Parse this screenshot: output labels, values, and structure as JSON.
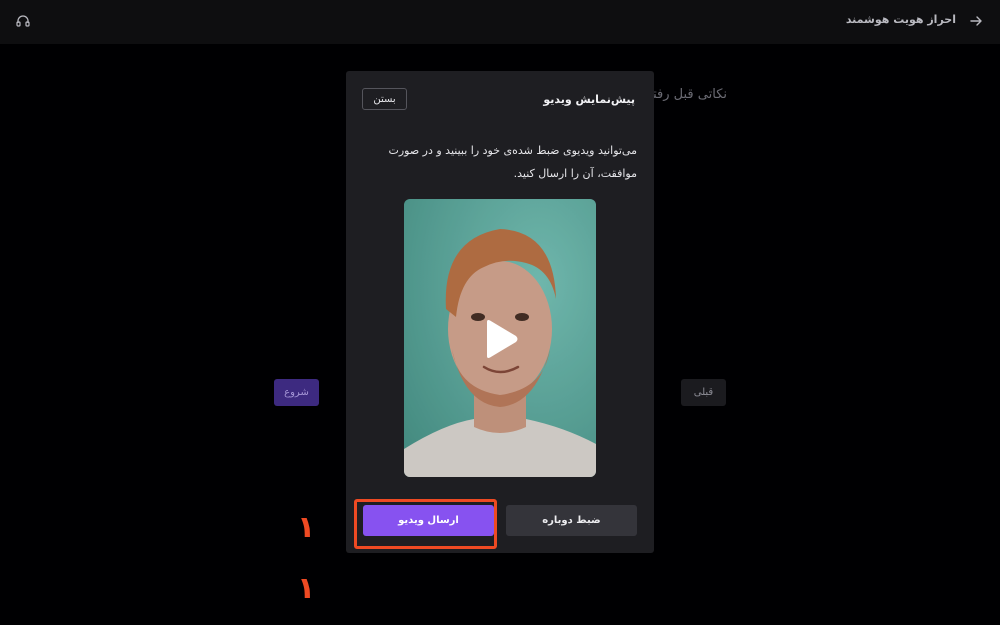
{
  "topbar": {
    "title": "احراز هویت هوشمند",
    "back_icon": "arrow-right-icon",
    "support_icon": "headset-icon"
  },
  "background": {
    "heading": "نکاتی قبل رفتن",
    "start_label": "شروع",
    "prev_label": "قبلی"
  },
  "modal": {
    "title": "پیش‌نمایش ویدیو",
    "close_label": "بستن",
    "description": "می‌توانید ویدیوی ضبط شده‌ی خود را ببینید و در صورت موافقت، آن را ارسال کنید.",
    "video": {
      "play_icon": "play-icon"
    },
    "send_label": "ارسال ویدیو",
    "rerecord_label": "ضبط دوباره"
  },
  "annotations": {
    "marker_1": "۱",
    "marker_2": "۱"
  },
  "colors": {
    "accent": "#8752f0",
    "highlight": "#ee4a23",
    "video_background": "#5ab3a6"
  }
}
